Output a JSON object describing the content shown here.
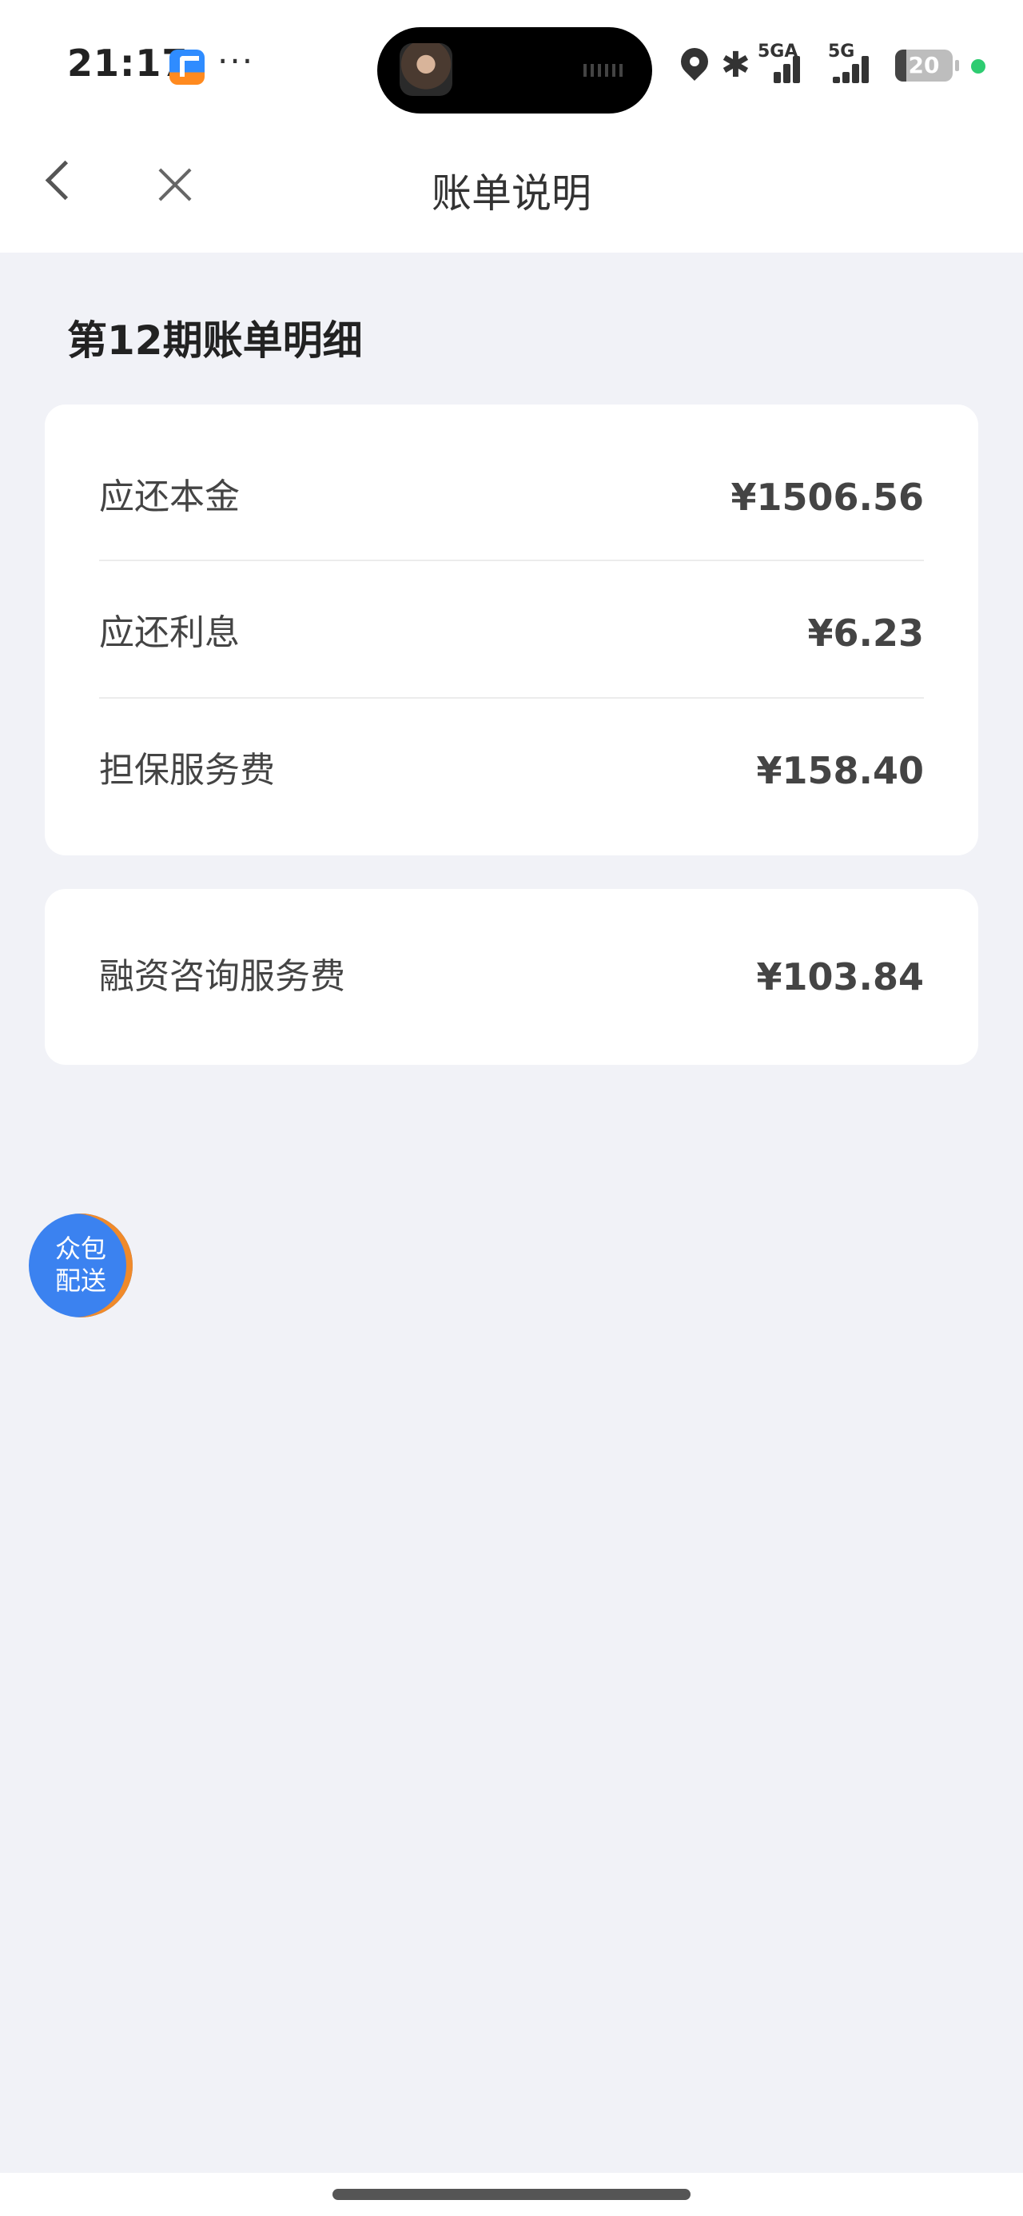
{
  "status_bar": {
    "time": "21:17",
    "more_dots": "···",
    "signal1_label": "5GA",
    "signal2_label": "5G",
    "battery_level": "20",
    "battery_fraction": 0.2,
    "dot_color": "#2ecc71"
  },
  "nav": {
    "title": "账单说明",
    "back_icon": "chevron-left-icon",
    "close_icon": "close-icon"
  },
  "bill": {
    "section_title": "第12期账单明细",
    "items": [
      {
        "label": "应还本金",
        "value": "¥1506.56"
      },
      {
        "label": "应还利息",
        "value": "¥6.23"
      },
      {
        "label": "担保服务费",
        "value": "¥158.40"
      }
    ],
    "extra_items": [
      {
        "label": "融资咨询服务费",
        "value": "¥103.84"
      }
    ]
  },
  "floating_button": {
    "line1": "众包",
    "line2": "配送",
    "color": "#3b82f0"
  }
}
